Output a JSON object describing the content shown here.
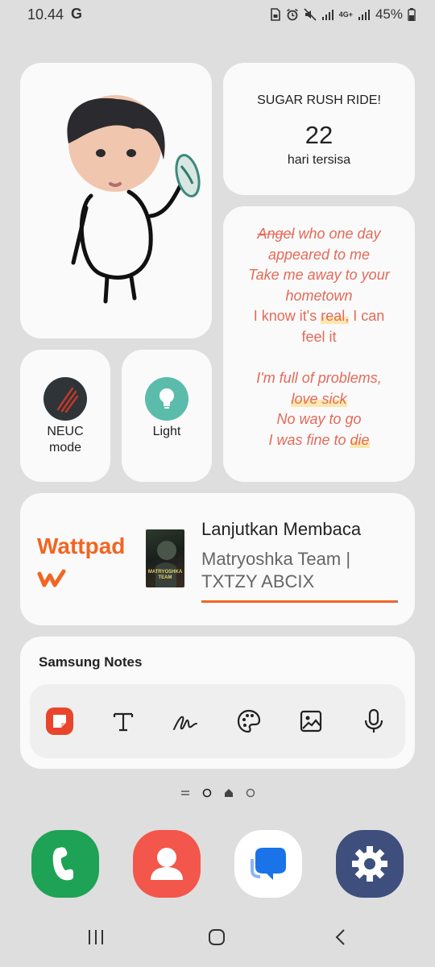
{
  "status_bar": {
    "time": "10.44",
    "google_g": "G",
    "network": "4G+",
    "battery": "45%"
  },
  "countdown": {
    "title": "SUGAR RUSH RIDE!",
    "days": "22",
    "caption": "hari tersisa"
  },
  "lyrics": {
    "l1_strike": "Angel",
    "l1_rest": " who one day",
    "l2": "appeared to me",
    "l3": "Take me away to your",
    "l4": "hometown",
    "l5a": "I know it's ",
    "l5b": "real,",
    "l5c": " I can",
    "l6": "feel it",
    "l7": "I'm full of problems,",
    "l8": "love sick",
    "l9": "No way to go",
    "l10a": "I was fine to ",
    "l10b": "die"
  },
  "quick_settings": {
    "neuc_line1": "NEUC",
    "neuc_line2": "mode",
    "light": "Light"
  },
  "wattpad": {
    "logo": "Wattpad",
    "heading": "Lanjutkan Membaca",
    "book_line1": "Matryoshka Team |",
    "book_line2": "TXTZY ABCIX",
    "cover_text1": "MATRYOSHKA",
    "cover_text2": "TEAM",
    "reading_progress": 0.99
  },
  "samsung_notes": {
    "title": "Samsung Notes",
    "actions": [
      "new-note",
      "text",
      "handwriting",
      "drawing",
      "image",
      "voice"
    ]
  },
  "dock": {
    "apps": [
      "Phone",
      "Contacts",
      "Messages",
      "Settings"
    ]
  },
  "colors": {
    "accent_wattpad": "#f26522",
    "lyrics": "#e46a58",
    "light_tile": "#5bbcab",
    "neuc_tile": "#2e3437"
  }
}
